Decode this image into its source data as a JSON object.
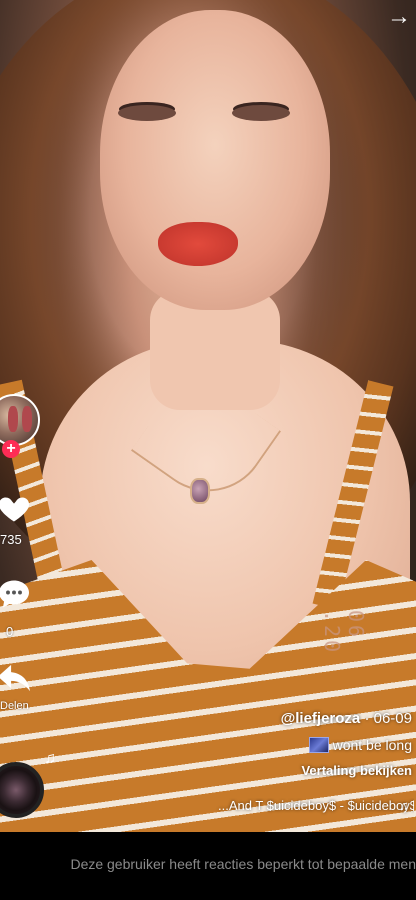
{
  "header": {
    "back_icon": "arrow-right-icon"
  },
  "actions": {
    "like_count": "735",
    "comment_count": "0",
    "share_label": "Delen"
  },
  "caption": {
    "author": "@liefjeroza",
    "date": "06-09",
    "description": "wont be long",
    "translate_label": "Vertaling bekijken"
  },
  "sound": {
    "text": "...And T   $uicideboy$ - $uicideboy$ - Ad"
  },
  "video": {
    "watermark": "06 .20"
  },
  "footer": {
    "restriction_message": "Deze gebruiker heeft reacties beperkt tot bepaalde men"
  },
  "colors": {
    "follow_accent": "#fe2c55",
    "footer_text": "#8a8a8a"
  }
}
